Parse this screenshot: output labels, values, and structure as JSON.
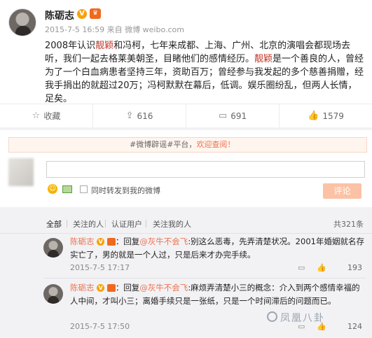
{
  "post": {
    "author": "陈砺志",
    "verified_badge": "V",
    "timestamp": "2015-7-5 16:59",
    "source_prefix": "来自",
    "source": "微博 weibo.com",
    "text_parts": [
      "2008年认识",
      "靓颖",
      "和冯柯，七年来成都、上海、广州、北京的演唱会都现场去听，我们一起去格莱美朝圣，目睹他们的感情经历。",
      "靓颖",
      "是一个善良的人，曾经为了一个白血病患者坚持三年，资助百万；曾经参与我发起的多个慈善捐赠，经我手捐出的就超过20万；冯柯默默在幕后，低调。娱乐圈纷乱，但两人长情，足矣。"
    ]
  },
  "actions": [
    {
      "label": "收藏",
      "icon": "star-icon"
    },
    {
      "label": "616",
      "icon": "repost-icon"
    },
    {
      "label": "691",
      "icon": "comment-icon"
    },
    {
      "label": "1579",
      "icon": "like-icon"
    }
  ],
  "compose": {
    "notice_hash": "#微博辟谣#",
    "notice_mid": "平台，",
    "notice_accent": "欢迎查阅！",
    "input_placeholder": "",
    "repost_checkbox_label": "同时转发到我的微博",
    "submit_label": "评论"
  },
  "filters": {
    "all": "全部",
    "following": "关注的人",
    "verified": "认证用户",
    "followers": "关注我的人",
    "total": "共321条"
  },
  "comments": [
    {
      "author": "陈砺志",
      "reply_prefix": "：回复",
      "mention": "@灰牛不会飞",
      "text": ":别这么恶毒，先弄清楚状况。2001年婚姻就名存实亡了，男的就是一个人过，只是后来才办完手续。",
      "time": "2015-7-5 17:17",
      "likes": "193"
    },
    {
      "author": "陈砺志",
      "reply_prefix": "：回复",
      "mention": "@灰牛不会飞",
      "text": ":麻烦弄清楚小三的概念：介入到两个感情幸福的人中间，才叫小三；离婚手续只是一张纸，只是一个时间滞后的问题而已。",
      "time": "2015-7-5 17:50",
      "likes": "124"
    }
  ],
  "watermark": "凤凰八卦",
  "colors": {
    "accent": "#eb7350",
    "highlight": "#c0392b",
    "badge_orange": "#f7a20a"
  }
}
